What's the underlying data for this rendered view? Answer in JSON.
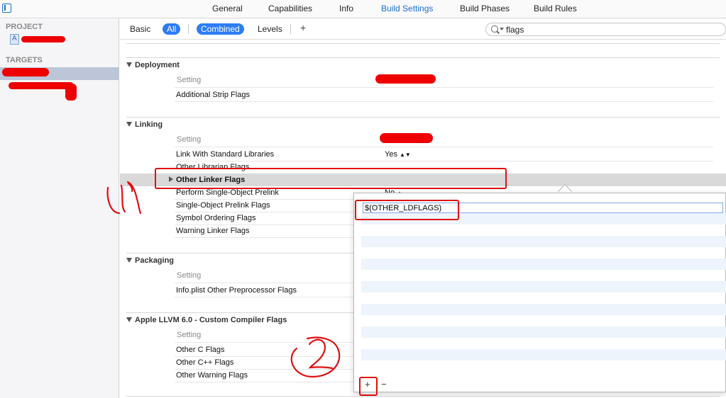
{
  "tabs": [
    "General",
    "Capabilities",
    "Info",
    "Build Settings",
    "Build Phases",
    "Build Rules"
  ],
  "active_tab": "Build Settings",
  "sidebar": {
    "project_header": "PROJECT",
    "targets_header": "TARGETS"
  },
  "filter": {
    "basic": "Basic",
    "all": "All",
    "combined": "Combined",
    "levels": "Levels",
    "add": "+",
    "search_value": "flags"
  },
  "column_header": "Setting",
  "groups": {
    "deployment": {
      "title": "Deployment",
      "settings": [
        "Additional Strip Flags"
      ]
    },
    "linking": {
      "title": "Linking",
      "settings": [
        "Link With Standard Libraries",
        "Other Librarian Flags",
        "Other Linker Flags",
        "Perform Single-Object Prelink",
        "Single-Object Prelink Flags",
        "Symbol Ordering Flags",
        "Warning Linker Flags"
      ],
      "values": {
        "link_with_standard_libraries": "Yes",
        "perform_single_object_prelink": "No"
      }
    },
    "packaging": {
      "title": "Packaging",
      "settings": [
        "Info.plist Other Preprocessor Flags"
      ]
    },
    "llvm": {
      "title": "Apple LLVM 6.0 - Custom Compiler Flags",
      "settings": [
        "Other C Flags",
        "Other C++ Flags",
        "Other Warning Flags"
      ]
    }
  },
  "popover": {
    "entry_value": "$(OTHER_LDFLAGS)",
    "add_label": "+",
    "remove_label": "−"
  },
  "annotations": [
    "1",
    "2",
    "3"
  ],
  "colors": {
    "accent": "#2d7cf6",
    "annotation": "#e01010",
    "redaction": "#ee0000"
  }
}
